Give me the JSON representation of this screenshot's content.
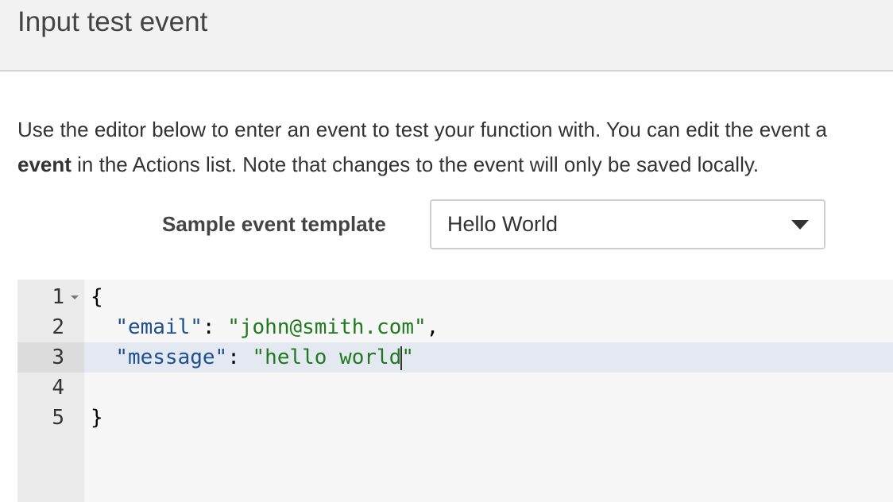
{
  "header": {
    "title": "Input test event"
  },
  "description": {
    "line1": "Use the editor below to enter an event to test your function with. You can edit the event a",
    "line2_bold": "event",
    "line2_rest": " in the Actions list. Note that changes to the event will only be saved locally."
  },
  "template": {
    "label": "Sample event template",
    "selected": "Hello World",
    "caret_icon": "caret-down-icon"
  },
  "editor": {
    "active_line": 3,
    "lines": [
      {
        "number": "1",
        "open_brace": "{"
      },
      {
        "number": "2",
        "key": "\"email\"",
        "sep": ": ",
        "value": "\"john@smith.com\"",
        "trail": ","
      },
      {
        "number": "3",
        "key": "\"message\"",
        "sep": ": ",
        "value_before_cursor": "\"hello world",
        "value_after_cursor": "\""
      },
      {
        "number": "4"
      },
      {
        "number": "5",
        "close_brace": "}"
      }
    ]
  }
}
